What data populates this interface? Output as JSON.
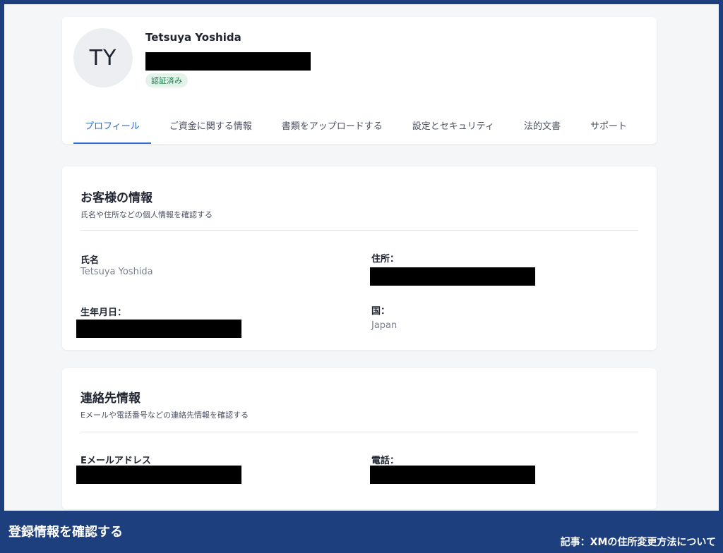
{
  "profile": {
    "initials": "TY",
    "name": "Tetsuya Yoshida",
    "status_badge": "認証済み"
  },
  "tabs": [
    {
      "label": "プロフィール",
      "active": true
    },
    {
      "label": "ご資金に関する情報",
      "active": false
    },
    {
      "label": "書類をアップロードする",
      "active": false
    },
    {
      "label": "設定とセキュリティ",
      "active": false
    },
    {
      "label": "法的文書",
      "active": false
    },
    {
      "label": "サポート",
      "active": false
    }
  ],
  "customer_info": {
    "title": "お客様の情報",
    "subtitle": "氏名や住所などの個人情報を確認する",
    "name_label": "氏名",
    "name_value": "Tetsuya Yoshida",
    "address_label": "住所：",
    "birthdate_label": "生年月日：",
    "country_label": "国：",
    "country_value": "Japan"
  },
  "contact_info": {
    "title": "連絡先情報",
    "subtitle": "Eメールや電話番号などの連絡先情報を確認する",
    "email_label": "Eメールアドレス",
    "phone_label": "電話："
  },
  "banner": {
    "title": "登録情報を確認する",
    "note": "記事：XMの住所変更方法について"
  },
  "colors": {
    "accent": "#2f6fd3",
    "frame": "#1d3f7d",
    "badge_bg": "#e3f3ea",
    "badge_text": "#1f7a4d"
  }
}
